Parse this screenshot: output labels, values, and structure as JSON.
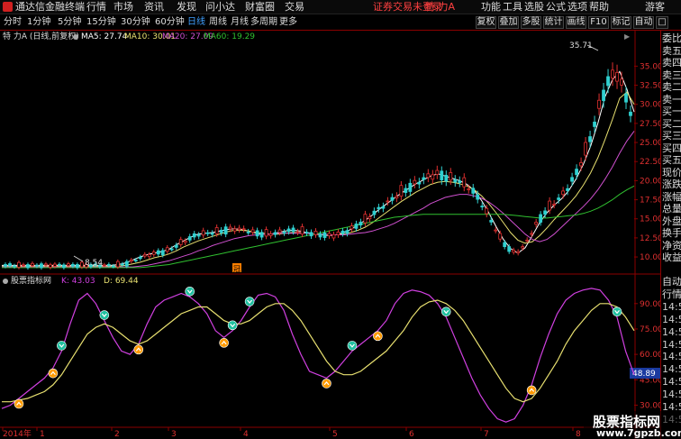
{
  "app": {
    "brand": "通达信金融终端",
    "menu": [
      "行情",
      "市场",
      "资讯",
      "发现",
      "问小达",
      "财富圈",
      "交易"
    ],
    "alert": "证券交易未登录",
    "stock_title": "特 力A",
    "tools": [
      "功能",
      "工具",
      "选股",
      "公式",
      "选项",
      "帮助"
    ],
    "guest": "游客"
  },
  "toolbar": {
    "periods": [
      "分时",
      "1分钟",
      "5分钟",
      "15分钟",
      "30分钟",
      "60分钟",
      "日线",
      "周线",
      "月线",
      "多周期",
      "更多"
    ],
    "active_period": "日线",
    "right_buttons": [
      "复权",
      "叠加",
      "多股",
      "统计",
      "画线",
      "F10",
      "标记",
      "自动",
      "□"
    ]
  },
  "info": {
    "stock": "特 力A (日线,前复权)",
    "ma5": "MA5: 27.74",
    "ma10": "MA10: 30.01",
    "ma20": "MA20: 27.09",
    "ma60": "MA60: 19.29"
  },
  "kdj": {
    "name": "股票指标网",
    "k": "K: 43.03",
    "d": "D: 69.44"
  },
  "right_panel": [
    "委比",
    "卖五",
    "卖四",
    "卖三",
    "卖二",
    "卖一",
    "买一",
    "买二",
    "买三",
    "买四",
    "买五",
    "现价",
    "涨跌",
    "涨幅",
    "总量",
    "外盘",
    "换手",
    "净资",
    "收益",
    "自动",
    "行情",
    "14:50",
    "14:50",
    "14:50",
    "14:50",
    "14:50",
    "14:50",
    "14:50",
    "14:50",
    "14:50",
    "14:5"
  ],
  "axis": {
    "price_ticks": [
      "35.00",
      "32.50",
      "30.00",
      "27.50",
      "25.00",
      "22.50",
      "20.00",
      "17.50",
      "15.00",
      "12.50",
      "10.00"
    ],
    "kdj_ticks": [
      "90.00",
      "75.00",
      "60.00",
      "45.00",
      "30.00"
    ],
    "kdj_current": "48.89",
    "dates": [
      "2014年",
      "1",
      "2",
      "3",
      "4",
      "5",
      "6",
      "7",
      "8"
    ],
    "max_label": "35.71",
    "min_label": "8.54",
    "flag_label": "冠",
    "scroll_arrow": "▶"
  },
  "colors": {
    "ma5": "#ffffff",
    "ma10": "#e8e070",
    "ma20": "#d050d0",
    "ma60": "#30c030",
    "k_line": "#d040e0",
    "d_line": "#e8e070",
    "up": "#e03030",
    "down": "#30d0d0",
    "panel_border": "#8b0000"
  },
  "watermark": {
    "line1": "股票指标网",
    "line2": "www.7gpzb.com"
  },
  "chart_data": [
    {
      "type": "candlestick",
      "title": "特 力A (日线,前复权)",
      "ylim": [
        8.0,
        38.0
      ],
      "x_labels": [
        "2014年",
        "1",
        "2",
        "3",
        "4",
        "5",
        "6",
        "7",
        "8"
      ],
      "series": [
        {
          "name": "MA5",
          "values": [
            8.9,
            8.9,
            8.9,
            8.9,
            8.9,
            8.9,
            8.9,
            8.9,
            8.9,
            8.9,
            8.9,
            8.9,
            8.9,
            8.9,
            8.9,
            8.9,
            9.0,
            9.2,
            9.6,
            10.0,
            10.3,
            10.5,
            10.7,
            11.0,
            11.6,
            12.1,
            12.6,
            13.0,
            13.1,
            13.2,
            13.4,
            13.6,
            13.7,
            13.6,
            13.4,
            13.1,
            13.0,
            13.0,
            13.2,
            13.4,
            13.5,
            13.4,
            13.2,
            13.0,
            12.9,
            12.8,
            12.9,
            13.2,
            13.6,
            14.2,
            14.8,
            15.5,
            16.3,
            17.0,
            17.7,
            18.4,
            19.0,
            19.6,
            20.1,
            20.6,
            20.9,
            20.6,
            20.3,
            20.0,
            19.5,
            18.7,
            17.4,
            15.8,
            14.0,
            12.3,
            11.1,
            10.5,
            11.2,
            12.8,
            14.5,
            15.8,
            16.8,
            17.6,
            18.7,
            20.2,
            22.1,
            24.5,
            27.5,
            31.0,
            33.2,
            34.3,
            32.0,
            29.0
          ]
        },
        {
          "name": "MA10",
          "values": [
            8.8,
            8.8,
            8.8,
            8.8,
            8.8,
            8.8,
            8.8,
            8.8,
            8.8,
            8.8,
            8.8,
            8.8,
            8.8,
            8.8,
            8.8,
            8.8,
            8.8,
            8.9,
            9.1,
            9.3,
            9.6,
            9.9,
            10.1,
            10.4,
            10.8,
            11.3,
            11.7,
            12.1,
            12.4,
            12.7,
            13.0,
            13.3,
            13.5,
            13.5,
            13.4,
            13.2,
            13.1,
            13.0,
            13.0,
            13.1,
            13.2,
            13.2,
            13.1,
            13.0,
            12.9,
            12.9,
            12.9,
            13.0,
            13.2,
            13.5,
            13.9,
            14.5,
            15.2,
            15.9,
            16.6,
            17.3,
            17.9,
            18.5,
            19.0,
            19.5,
            19.8,
            19.9,
            19.8,
            19.6,
            19.3,
            18.8,
            18.0,
            17.0,
            15.8,
            14.5,
            13.2,
            12.2,
            11.8,
            12.0,
            12.8,
            13.8,
            14.9,
            15.9,
            16.9,
            18.0,
            19.4,
            21.0,
            23.0,
            25.4,
            28.0,
            30.8,
            31.6,
            30.0
          ]
        },
        {
          "name": "MA20",
          "values": [
            8.7,
            8.7,
            8.7,
            8.7,
            8.7,
            8.7,
            8.7,
            8.7,
            8.7,
            8.7,
            8.7,
            8.7,
            8.7,
            8.7,
            8.7,
            8.7,
            8.7,
            8.7,
            8.7,
            8.8,
            8.9,
            9.1,
            9.3,
            9.5,
            9.8,
            10.1,
            10.4,
            10.8,
            11.1,
            11.5,
            11.8,
            12.1,
            12.4,
            12.6,
            12.8,
            12.9,
            13.0,
            13.0,
            13.1,
            13.1,
            13.1,
            13.1,
            13.1,
            13.0,
            13.0,
            12.9,
            12.9,
            12.9,
            13.0,
            13.1,
            13.2,
            13.4,
            13.7,
            14.0,
            14.4,
            14.9,
            15.4,
            15.9,
            16.4,
            17.0,
            17.4,
            17.8,
            18.0,
            18.2,
            18.2,
            18.0,
            17.7,
            17.2,
            16.5,
            15.7,
            14.8,
            13.9,
            13.0,
            12.3,
            12.0,
            12.3,
            13.0,
            13.9,
            14.8,
            15.7,
            16.6,
            17.6,
            18.8,
            20.2,
            21.8,
            23.6,
            25.2,
            26.5
          ]
        },
        {
          "name": "MA60",
          "values": [
            8.6,
            8.6,
            8.6,
            8.6,
            8.6,
            8.6,
            8.6,
            8.6,
            8.6,
            8.6,
            8.6,
            8.6,
            8.6,
            8.6,
            8.6,
            8.6,
            8.6,
            8.6,
            8.6,
            8.6,
            8.7,
            8.8,
            8.9,
            9.0,
            9.2,
            9.4,
            9.6,
            9.8,
            10.0,
            10.2,
            10.4,
            10.6,
            10.8,
            11.0,
            11.2,
            11.4,
            11.6,
            11.8,
            12.0,
            12.2,
            12.4,
            12.6,
            12.8,
            13.0,
            13.2,
            13.4,
            13.6,
            13.8,
            14.0,
            14.2,
            14.4,
            14.6,
            14.8,
            15.0,
            15.2,
            15.3,
            15.4,
            15.5,
            15.6,
            15.6,
            15.6,
            15.6,
            15.6,
            15.6,
            15.6,
            15.6,
            15.6,
            15.6,
            15.6,
            15.6,
            15.5,
            15.4,
            15.3,
            15.2,
            15.1,
            15.1,
            15.2,
            15.3,
            15.4,
            15.5,
            15.7,
            16.0,
            16.4,
            16.9,
            17.5,
            18.2,
            18.8,
            19.3
          ]
        }
      ]
    },
    {
      "type": "line",
      "title": "股票指标网",
      "ylim": [
        18,
        100
      ],
      "x_labels": [
        "2014年",
        "1",
        "2",
        "3",
        "4",
        "5",
        "6",
        "7",
        "8"
      ],
      "series": [
        {
          "name": "K",
          "values": [
            28,
            30,
            34,
            38,
            42,
            46,
            52,
            62,
            78,
            92,
            96,
            90,
            80,
            70,
            62,
            60,
            66,
            78,
            88,
            92,
            94,
            96,
            94,
            90,
            84,
            74,
            70,
            74,
            80,
            88,
            95,
            96,
            94,
            86,
            72,
            60,
            50,
            48,
            46,
            50,
            56,
            62,
            66,
            70,
            74,
            80,
            90,
            96,
            98,
            97,
            95,
            90,
            82,
            70,
            58,
            46,
            36,
            28,
            22,
            20,
            22,
            30,
            42,
            58,
            72,
            84,
            92,
            96,
            98,
            99,
            98,
            92,
            82,
            62,
            48
          ]
        },
        {
          "name": "D",
          "values": [
            32,
            32,
            33,
            34,
            36,
            38,
            42,
            48,
            56,
            64,
            72,
            76,
            78,
            76,
            72,
            68,
            66,
            68,
            72,
            76,
            80,
            84,
            86,
            88,
            88,
            84,
            80,
            78,
            78,
            80,
            84,
            88,
            90,
            90,
            86,
            80,
            72,
            64,
            56,
            50,
            48,
            48,
            50,
            54,
            58,
            62,
            68,
            74,
            82,
            88,
            91,
            92,
            90,
            86,
            80,
            72,
            64,
            56,
            48,
            40,
            34,
            32,
            34,
            40,
            48,
            56,
            66,
            74,
            80,
            86,
            90,
            90,
            88,
            82,
            74
          ]
        }
      ],
      "markers": [
        {
          "type": "up",
          "index": 2
        },
        {
          "type": "up",
          "index": 6
        },
        {
          "type": "down",
          "index": 7
        },
        {
          "type": "down",
          "index": 12
        },
        {
          "type": "up",
          "index": 16
        },
        {
          "type": "down",
          "index": 22
        },
        {
          "type": "up",
          "index": 26
        },
        {
          "type": "down",
          "index": 27
        },
        {
          "type": "down",
          "index": 29
        },
        {
          "type": "up",
          "index": 38
        },
        {
          "type": "down",
          "index": 41
        },
        {
          "type": "up",
          "index": 44
        },
        {
          "type": "down",
          "index": 52
        },
        {
          "type": "up",
          "index": 62
        },
        {
          "type": "down",
          "index": 72
        }
      ]
    }
  ]
}
